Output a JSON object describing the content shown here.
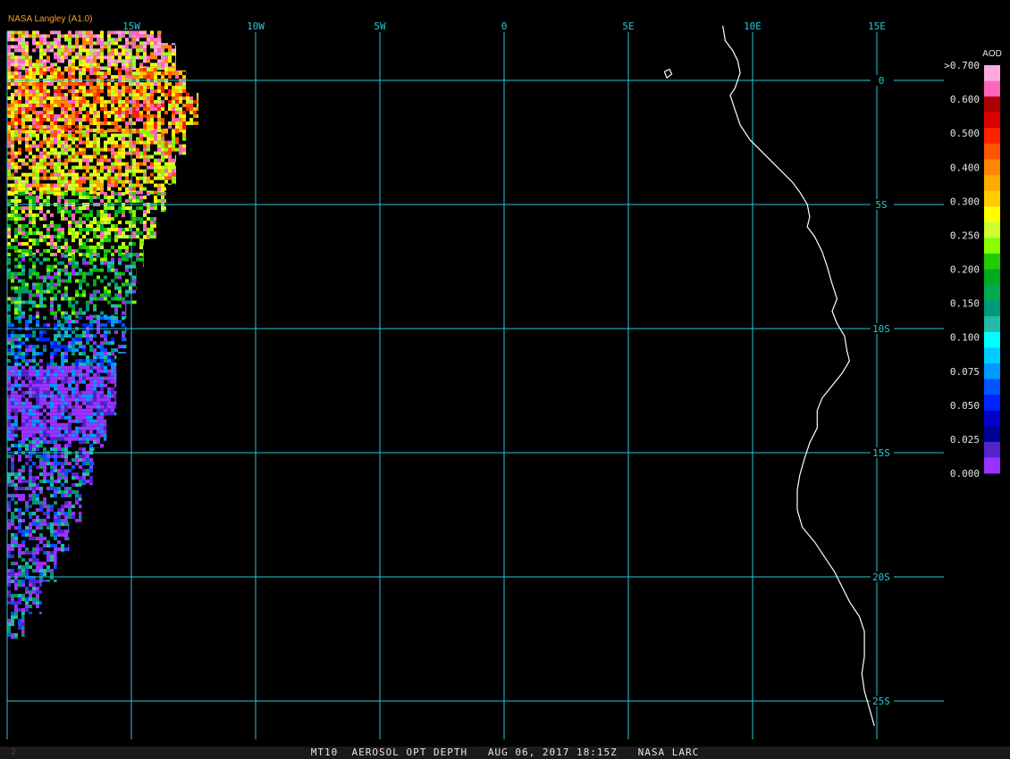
{
  "credit": "NASA Langley (A1.0)",
  "status_bar": {
    "index": "2",
    "text": "MT10  AEROSOL OPT DEPTH   AUG 06, 2017 18:15Z   NASA LARC"
  },
  "colors": {
    "grid": "#27c9d8",
    "coastline": "#ffffff",
    "credit": "#f0a030",
    "status_bg": "#1a1a1a"
  },
  "map": {
    "lon_range": [
      -20,
      15
    ],
    "lat_range": [
      2,
      -26
    ],
    "lon_gridlines": [
      {
        "value": -20,
        "label": ""
      },
      {
        "value": -15,
        "label": "15W"
      },
      {
        "value": -10,
        "label": "10W"
      },
      {
        "value": -5,
        "label": "5W"
      },
      {
        "value": 0,
        "label": "0"
      },
      {
        "value": 5,
        "label": "5E"
      },
      {
        "value": 10,
        "label": "10E"
      },
      {
        "value": 15,
        "label": "15E"
      }
    ],
    "lat_gridlines": [
      {
        "value": 0,
        "label": "0"
      },
      {
        "value": -5,
        "label": "5S"
      },
      {
        "value": -10,
        "label": "10S"
      },
      {
        "value": -15,
        "label": "15S"
      },
      {
        "value": -20,
        "label": "20S"
      },
      {
        "value": -25,
        "label": "25S"
      }
    ],
    "coastline_lonlat": [
      [
        8.8,
        2.2
      ],
      [
        8.9,
        1.6
      ],
      [
        9.2,
        1.2
      ],
      [
        9.4,
        0.8
      ],
      [
        9.5,
        0.3
      ],
      [
        9.3,
        -0.3
      ],
      [
        9.1,
        -0.6
      ],
      [
        9.3,
        -1.2
      ],
      [
        9.5,
        -1.8
      ],
      [
        9.9,
        -2.4
      ],
      [
        10.5,
        -3.0
      ],
      [
        11.1,
        -3.6
      ],
      [
        11.6,
        -4.1
      ],
      [
        11.9,
        -4.5
      ],
      [
        12.2,
        -5.0
      ],
      [
        12.3,
        -5.5
      ],
      [
        12.2,
        -5.9
      ],
      [
        12.5,
        -6.3
      ],
      [
        12.8,
        -6.9
      ],
      [
        13.0,
        -7.5
      ],
      [
        13.2,
        -8.2
      ],
      [
        13.4,
        -8.8
      ],
      [
        13.2,
        -9.3
      ],
      [
        13.4,
        -9.8
      ],
      [
        13.7,
        -10.3
      ],
      [
        13.8,
        -10.9
      ],
      [
        13.9,
        -11.3
      ],
      [
        13.6,
        -11.8
      ],
      [
        13.2,
        -12.3
      ],
      [
        12.8,
        -12.8
      ],
      [
        12.6,
        -13.3
      ],
      [
        12.6,
        -14.0
      ],
      [
        12.3,
        -14.6
      ],
      [
        12.1,
        -15.2
      ],
      [
        11.9,
        -15.9
      ],
      [
        11.8,
        -16.5
      ],
      [
        11.8,
        -17.3
      ],
      [
        12.0,
        -18.0
      ],
      [
        12.5,
        -18.6
      ],
      [
        12.9,
        -19.2
      ],
      [
        13.3,
        -19.8
      ],
      [
        13.6,
        -20.4
      ],
      [
        13.9,
        -21.0
      ],
      [
        14.3,
        -21.6
      ],
      [
        14.5,
        -22.2
      ],
      [
        14.5,
        -22.6
      ],
      [
        14.5,
        -23.2
      ],
      [
        14.4,
        -23.9
      ],
      [
        14.5,
        -24.6
      ],
      [
        14.7,
        -25.3
      ],
      [
        14.9,
        -26.0
      ]
    ],
    "bioko_island_lonlat": [
      [
        6.45,
        0.35
      ],
      [
        6.65,
        0.45
      ],
      [
        6.75,
        0.25
      ],
      [
        6.55,
        0.1
      ],
      [
        6.45,
        0.35
      ]
    ]
  },
  "legend": {
    "title": "AOD",
    "labels": [
      ">0.700",
      "0.600",
      "0.500",
      "0.400",
      "0.300",
      "0.250",
      "0.200",
      "0.150",
      "0.100",
      "0.075",
      "0.050",
      "0.025",
      "0.000"
    ],
    "colors": [
      "#ffaadd",
      "#ff66bb",
      "#b00000",
      "#dd0000",
      "#ff2200",
      "#ff5500",
      "#ff8800",
      "#ffaa00",
      "#ffcc00",
      "#ffff00",
      "#ccff33",
      "#88ff00",
      "#22cc00",
      "#00aa22",
      "#00aa55",
      "#009977",
      "#22bbaa",
      "#00ffff",
      "#00ccff",
      "#0099ff",
      "#0055ff",
      "#0022ff",
      "#0000cc",
      "#000099",
      "#5522cc",
      "#9933ff"
    ]
  },
  "swath": {
    "boundary_lonlat": [
      [
        -20,
        2.0
      ],
      [
        -13.8,
        2.0
      ],
      [
        -13.8,
        1.5
      ],
      [
        -13.2,
        1.5
      ],
      [
        -13.2,
        0.4
      ],
      [
        -12.8,
        0.4
      ],
      [
        -12.8,
        -0.5
      ],
      [
        -12.3,
        -0.5
      ],
      [
        -12.3,
        -1.8
      ],
      [
        -12.8,
        -1.8
      ],
      [
        -12.8,
        -3.0
      ],
      [
        -13.2,
        -3.0
      ],
      [
        -13.2,
        -4.2
      ],
      [
        -13.6,
        -4.2
      ],
      [
        -13.6,
        -5.3
      ],
      [
        -14.0,
        -5.3
      ],
      [
        -14.0,
        -6.4
      ],
      [
        -14.5,
        -6.4
      ],
      [
        -14.5,
        -7.5
      ],
      [
        -14.8,
        -7.5
      ],
      [
        -14.8,
        -9.0
      ],
      [
        -15.2,
        -9.0
      ],
      [
        -15.2,
        -11.0
      ],
      [
        -15.6,
        -11.0
      ],
      [
        -15.6,
        -13.5
      ],
      [
        -16.0,
        -13.5
      ],
      [
        -16.0,
        -14.8
      ],
      [
        -16.5,
        -14.8
      ],
      [
        -16.5,
        -16.3
      ],
      [
        -17.0,
        -16.3
      ],
      [
        -17.0,
        -17.8
      ],
      [
        -17.5,
        -17.8
      ],
      [
        -17.5,
        -19.0
      ],
      [
        -18.0,
        -19.0
      ],
      [
        -18.0,
        -20.2
      ],
      [
        -18.6,
        -20.2
      ],
      [
        -18.6,
        -21.5
      ],
      [
        -19.3,
        -21.5
      ],
      [
        -19.3,
        -22.5
      ],
      [
        -20,
        -22.5
      ]
    ],
    "bands": [
      {
        "lat_top": 2.0,
        "lat_bottom": 0.5,
        "colors": [
          "#ff66bb",
          "#ffaadd",
          "#ff88cc",
          "#ffff00",
          "#ff8800",
          "#99ff33"
        ],
        "density": 0.78
      },
      {
        "lat_top": 0.5,
        "lat_bottom": -2.0,
        "colors": [
          "#ffcc00",
          "#ff5500",
          "#ff66bb",
          "#ffff00",
          "#ff8800",
          "#ccff33",
          "#ff2200"
        ],
        "density": 0.8
      },
      {
        "lat_top": -2.0,
        "lat_bottom": -4.5,
        "colors": [
          "#ffff00",
          "#ccff33",
          "#ffaa00",
          "#ff66bb",
          "#88ff00",
          "#ff5500"
        ],
        "density": 0.72
      },
      {
        "lat_top": -4.5,
        "lat_bottom": -7.0,
        "colors": [
          "#22cc00",
          "#88ff00",
          "#ccff33",
          "#ffff00",
          "#ff66bb",
          "#00aa22"
        ],
        "density": 0.6
      },
      {
        "lat_top": -7.0,
        "lat_bottom": -9.5,
        "colors": [
          "#22cc00",
          "#00aa22",
          "#009977",
          "#88ff00",
          "#22bbaa",
          "#9933ff"
        ],
        "density": 0.5
      },
      {
        "lat_top": -9.5,
        "lat_bottom": -11.5,
        "colors": [
          "#0055ff",
          "#0099ff",
          "#0022ff",
          "#9933ff",
          "#22bbaa",
          "#009977"
        ],
        "density": 0.55
      },
      {
        "lat_top": -11.5,
        "lat_bottom": -14.5,
        "colors": [
          "#9933ff",
          "#9933ff",
          "#9933ff",
          "#5522cc",
          "#0099ff"
        ],
        "density": 0.85
      },
      {
        "lat_top": -14.5,
        "lat_bottom": -22.5,
        "colors": [
          "#9933ff",
          "#9933ff",
          "#5522cc",
          "#22bbaa",
          "#0055ff",
          "#009977"
        ],
        "density": 0.62
      }
    ]
  }
}
